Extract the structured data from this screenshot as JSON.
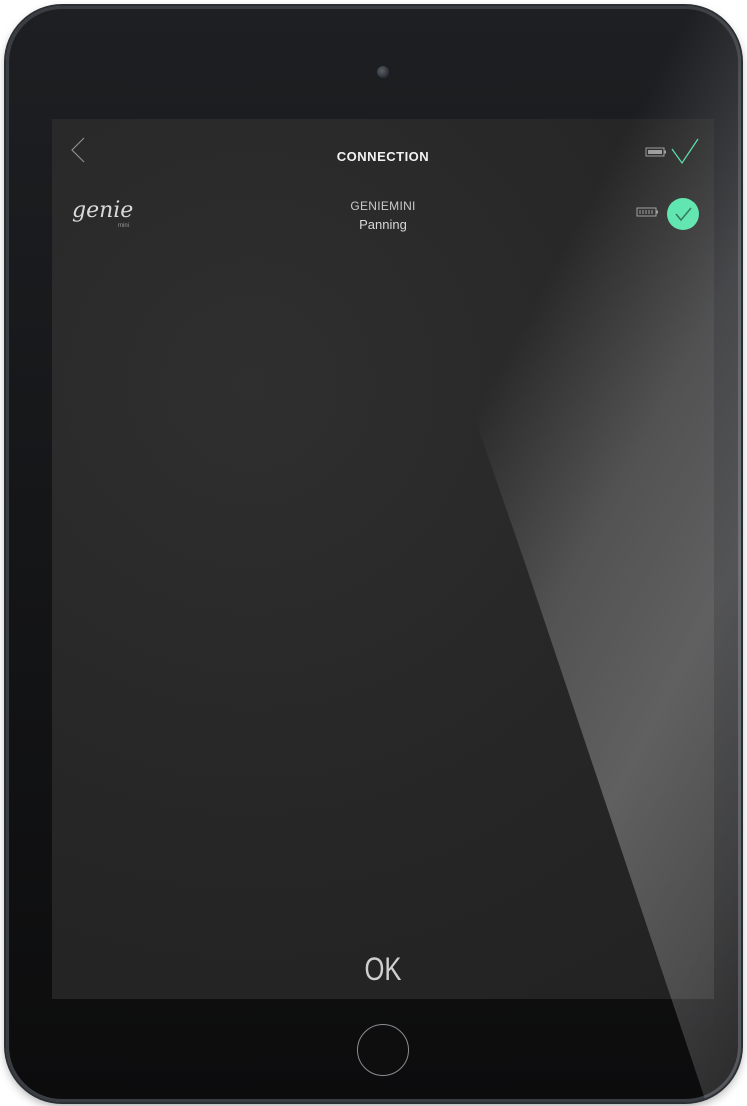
{
  "header": {
    "title": "CONNECTION",
    "back_icon": "chevron-left-icon",
    "status_icons": [
      "battery-icon",
      "checkmark-icon"
    ]
  },
  "device": {
    "logo_text": "genie",
    "logo_subtext": "mini",
    "name": "GENIEMINI",
    "mode": "Panning",
    "battery_icon": "battery-icon",
    "connected_icon": "check-circle-icon",
    "connected_color": "#4fe3a6"
  },
  "footer": {
    "ok_label": "OK"
  }
}
